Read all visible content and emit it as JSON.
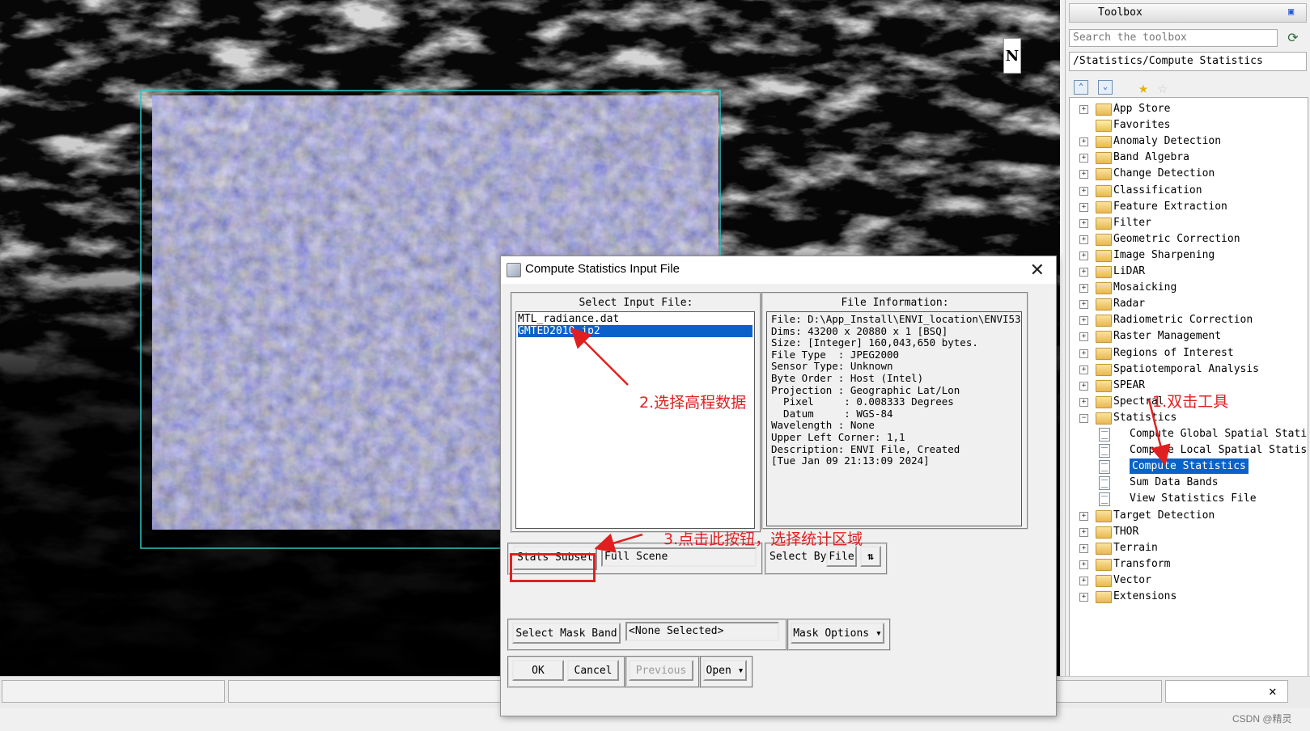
{
  "toolbox": {
    "title": "Toolbox",
    "search_placeholder": "Search the toolbox",
    "path": "/Statistics/Compute Statistics",
    "tree": [
      {
        "label": "App Store",
        "type": "folder"
      },
      {
        "label": "Favorites",
        "type": "favorites"
      },
      {
        "label": "Anomaly Detection",
        "type": "folder"
      },
      {
        "label": "Band Algebra",
        "type": "folder"
      },
      {
        "label": "Change Detection",
        "type": "folder"
      },
      {
        "label": "Classification",
        "type": "folder"
      },
      {
        "label": "Feature Extraction",
        "type": "folder"
      },
      {
        "label": "Filter",
        "type": "folder"
      },
      {
        "label": "Geometric Correction",
        "type": "folder"
      },
      {
        "label": "Image Sharpening",
        "type": "folder"
      },
      {
        "label": "LiDAR",
        "type": "folder"
      },
      {
        "label": "Mosaicking",
        "type": "folder"
      },
      {
        "label": "Radar",
        "type": "folder"
      },
      {
        "label": "Radiometric Correction",
        "type": "folder"
      },
      {
        "label": "Raster Management",
        "type": "folder"
      },
      {
        "label": "Regions of Interest",
        "type": "folder"
      },
      {
        "label": "Spatiotemporal Analysis",
        "type": "folder"
      },
      {
        "label": "SPEAR",
        "type": "folder"
      },
      {
        "label": "Spectral",
        "type": "folder"
      },
      {
        "label": "Statistics",
        "type": "folder-open"
      },
      {
        "label": "Compute Global Spatial Stati",
        "type": "tool"
      },
      {
        "label": "Compute Local Spatial Statis",
        "type": "tool"
      },
      {
        "label": "Compute Statistics",
        "type": "tool",
        "selected": true
      },
      {
        "label": "Sum Data Bands",
        "type": "tool"
      },
      {
        "label": "View Statistics File",
        "type": "tool"
      },
      {
        "label": "Target Detection",
        "type": "folder"
      },
      {
        "label": "THOR",
        "type": "folder"
      },
      {
        "label": "Terrain",
        "type": "folder"
      },
      {
        "label": "Transform",
        "type": "folder"
      },
      {
        "label": "Vector",
        "type": "folder"
      },
      {
        "label": "Extensions",
        "type": "folder"
      }
    ]
  },
  "dialog": {
    "title": "Compute Statistics Input File",
    "select_input_header": "Select Input File:",
    "files": [
      "MTL_radiance.dat",
      "GMTED2010.jp2"
    ],
    "selected_file_index": 1,
    "file_info_header": "File Information:",
    "file_info": [
      "File: D:\\App_Install\\ENVI_location\\ENVI53",
      "Dims: 43200 x 20880 x 1 [BSQ]",
      "Size: [Integer] 160,043,650 bytes.",
      "File Type  : JPEG2000",
      "Sensor Type: Unknown",
      "Byte Order : Host (Intel)",
      "Projection : Geographic Lat/Lon",
      "  Pixel     : 0.008333 Degrees",
      "  Datum     : WGS-84",
      "Wavelength : None",
      "Upper Left Corner: 1,1",
      "Description: ENVI File, Created",
      "[Tue Jan 09 21:13:09 2024]"
    ],
    "stats_subset_label": "Stats Subset",
    "full_scene_value": "Full Scene",
    "select_by_label": "Select By",
    "select_by_value": "File",
    "select_mask_band_label": "Select Mask Band",
    "mask_value": "<None Selected>",
    "mask_options_label": "Mask Options",
    "ok_label": "OK",
    "cancel_label": "Cancel",
    "previous_label": "Previous",
    "open_label": "Open"
  },
  "annotations": {
    "step1": "1.双击工具",
    "step2": "2.选择高程数据",
    "step3": "3.点击此按钮，选择统计区域"
  },
  "map": {
    "north_label": "N"
  },
  "watermark": "CSDN @精灵",
  "colors": {
    "selection": "#0a62c8",
    "annotation": "#e02020",
    "extent_box": "#2ec4c4"
  }
}
